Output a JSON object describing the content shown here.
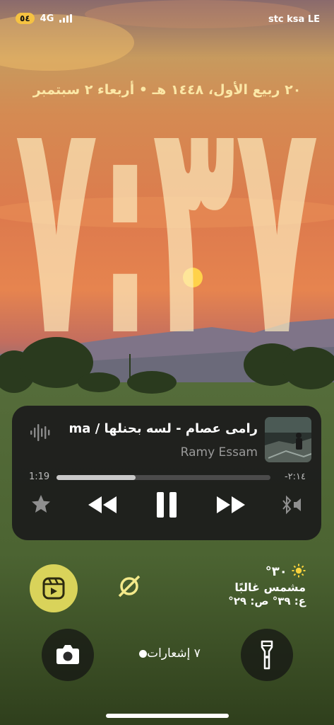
{
  "status_bar": {
    "battery": "٥٤",
    "network": "4G",
    "carrier": "stc ksa LE"
  },
  "lock": {
    "date": "٢٠ ربيع الأول، ١٤٤٨ هـ • أربعاء ٢ سبتمبر",
    "time": "٧:٣٧"
  },
  "player": {
    "title": "رامى عصام - لسه بحنلها / ma",
    "artist": "Ramy Essam",
    "elapsed": "1:19",
    "remaining": "-٢:١٤",
    "progress": 0.37,
    "icons": [
      "waveform-icon",
      "star-icon",
      "rewind-icon",
      "pause-icon",
      "fast-forward-icon",
      "bluetooth-speaker-icon"
    ]
  },
  "weather": {
    "temp": "٣٠°",
    "condition": "مشمس غالبًا",
    "range": "ع: ٣٩° ص: ٢٩°"
  },
  "notifications": {
    "label": "٧ إشعارات"
  },
  "colors": {
    "date": "#fbe7a6",
    "clock": "#fdeec0",
    "focus": "#d9d35a",
    "player_bg": "#1c1c1c"
  }
}
